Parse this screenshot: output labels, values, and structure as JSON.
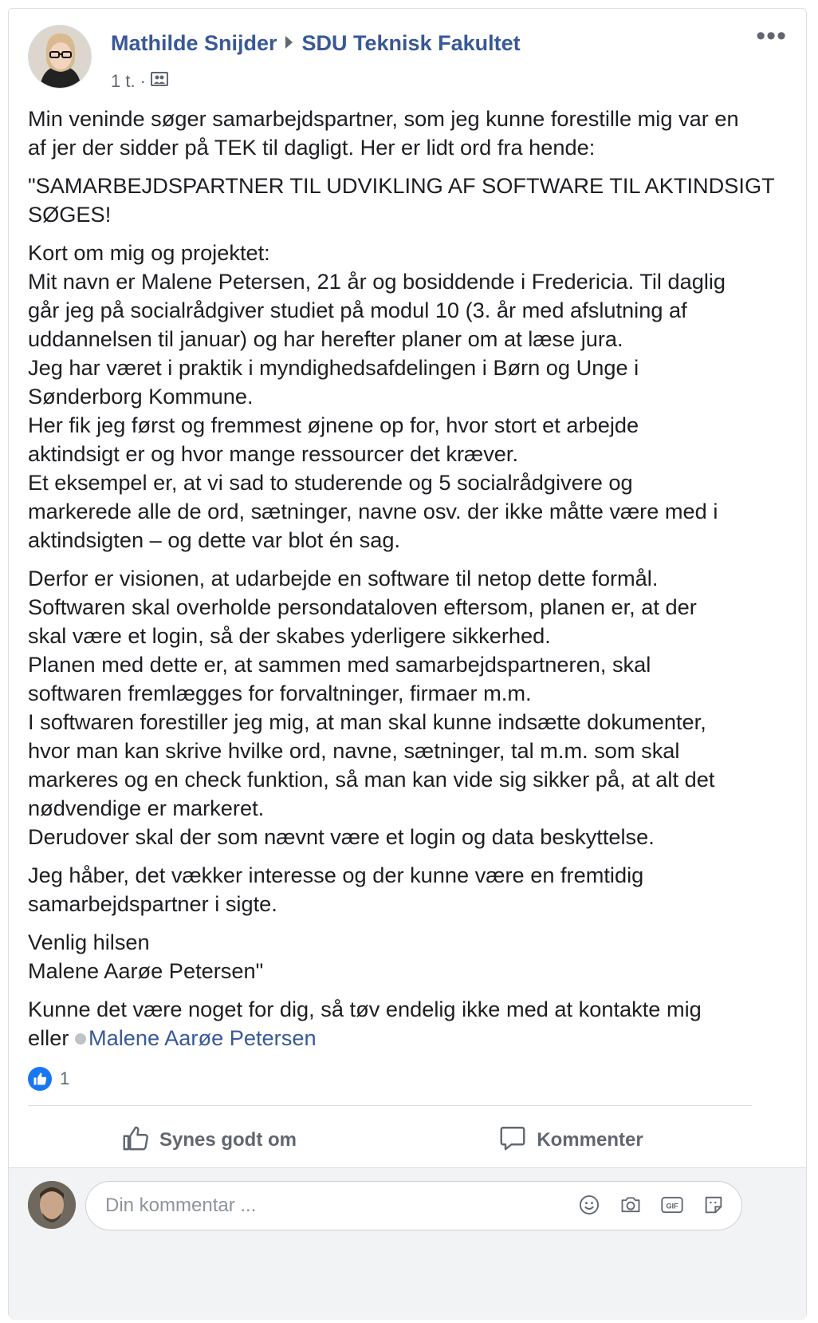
{
  "post": {
    "author": "Mathilde Snijder",
    "group": "SDU Teknisk Fakultet",
    "time": "1 t.",
    "separator": "·",
    "more_label": "•••",
    "paragraphs": [
      [
        "Min veninde søger samarbejdspartner, som jeg kunne forestille mig var en",
        "af jer der sidder på TEK til dagligt. Her er lidt ord fra hende:"
      ],
      [
        "\"SAMARBEJDSPARTNER TIL UDVIKLING AF SOFTWARE TIL AKTINDSIGT",
        "SØGES!"
      ],
      [
        "Kort om mig og projektet:",
        "Mit navn er Malene Petersen, 21 år og bosiddende i Fredericia. Til daglig",
        "går jeg på socialrådgiver studiet på modul 10 (3. år med afslutning af",
        "uddannelsen til januar) og har herefter planer om at læse jura.",
        "Jeg har været i praktik i myndighedsafdelingen i Børn og Unge i",
        "Sønderborg Kommune.",
        "Her fik jeg først og fremmest øjnene op for, hvor stort et arbejde",
        "aktindsigt er og hvor mange ressourcer det kræver.",
        "Et eksempel er, at vi sad to studerende og 5 socialrådgivere og",
        "markerede alle de ord, sætninger, navne osv. der ikke måtte være med i",
        "aktindsigten – og dette var blot én sag."
      ],
      [
        "Derfor er visionen, at udarbejde en software til netop dette formål.",
        "Softwaren skal overholde persondataloven eftersom, planen er, at der",
        "skal være et login, så der skabes yderligere sikkerhed.",
        "Planen med dette er, at sammen med samarbejdspartneren, skal",
        "softwaren fremlægges for forvaltninger, firmaer m.m.",
        "I softwaren forestiller jeg mig, at man skal kunne indsætte dokumenter,",
        "hvor man kan skrive hvilke ord, navne, sætninger, tal m.m. som skal",
        "markeres og en check funktion, så man kan vide sig sikker på, at alt det",
        "nødvendige er markeret.",
        "Derudover skal der som nævnt være et login og data beskyttelse."
      ],
      [
        "Jeg håber, det vækker interesse og der kunne være en fremtidig",
        "samarbejdspartner i sigte."
      ],
      [
        "Venlig hilsen",
        "Malene Aarøe Petersen\""
      ]
    ],
    "closing_line1": "Kunne det være noget for dig, så tøv endelig ikke med at kontakte mig",
    "closing_prefix": "eller ",
    "mention": "Malene Aarøe Petersen",
    "reaction_count": "1",
    "like_label": "Synes godt om",
    "comment_label": "Kommenter",
    "comment_placeholder": "Din kommentar ..."
  },
  "colors": {
    "link": "#385898",
    "like_blue": "#1877f2",
    "muted": "#606770"
  },
  "icons": [
    "group-audience-icon",
    "like-reaction-icon",
    "thumbs-up-icon",
    "comment-icon",
    "emoji-icon",
    "camera-icon",
    "gif-icon",
    "sticker-icon"
  ]
}
